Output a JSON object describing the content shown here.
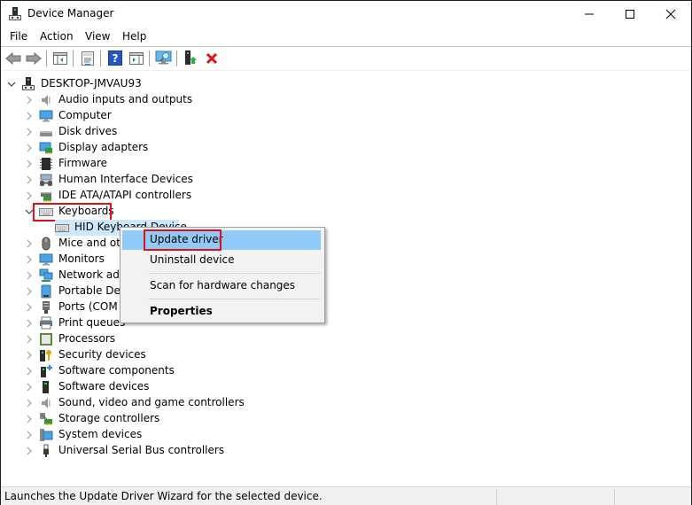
{
  "window": {
    "title": "Device Manager",
    "controls": {
      "minimize": "minimize",
      "maximize": "maximize",
      "close": "close"
    }
  },
  "menu": [
    "File",
    "Action",
    "View",
    "Help"
  ],
  "toolbar": {
    "buttons": [
      {
        "icon": "back-arrow-icon"
      },
      {
        "icon": "forward-arrow-icon"
      },
      {
        "icon": "show-hide-console-tree-icon"
      },
      {
        "icon": "properties-sheet-icon"
      },
      {
        "icon": "help-icon"
      },
      {
        "icon": "show-action-pane-icon"
      },
      {
        "icon": "scan-hardware-icon"
      },
      {
        "icon": "update-driver-icon"
      },
      {
        "icon": "uninstall-red-x-icon"
      }
    ]
  },
  "tree": {
    "root": "DESKTOP-JMVAU93",
    "categories": [
      {
        "label": "Audio inputs and outputs",
        "icon": "speaker-icon"
      },
      {
        "label": "Computer",
        "icon": "monitor-icon"
      },
      {
        "label": "Disk drives",
        "icon": "disk-drive-icon"
      },
      {
        "label": "Display adapters",
        "icon": "display-adapter-icon"
      },
      {
        "label": "Firmware",
        "icon": "chip-icon"
      },
      {
        "label": "Human Interface Devices",
        "icon": "hid-icon"
      },
      {
        "label": "IDE ATA/ATAPI controllers",
        "icon": "ide-controller-icon"
      },
      {
        "label": "Keyboards",
        "icon": "keyboard-icon",
        "expanded": true,
        "children": [
          "HID Keyboard Device"
        ]
      },
      {
        "label": "Mice and other pointing devices",
        "icon": "mouse-icon"
      },
      {
        "label": "Monitors",
        "icon": "monitor-icon"
      },
      {
        "label": "Network adapters",
        "icon": "network-icon"
      },
      {
        "label": "Portable Devices",
        "icon": "portable-device-icon"
      },
      {
        "label": "Ports (COM & LPT)",
        "icon": "port-icon"
      },
      {
        "label": "Print queues",
        "icon": "printer-icon"
      },
      {
        "label": "Processors",
        "icon": "processor-icon"
      },
      {
        "label": "Security devices",
        "icon": "security-key-icon"
      },
      {
        "label": "Software components",
        "icon": "software-component-icon"
      },
      {
        "label": "Software devices",
        "icon": "software-device-icon"
      },
      {
        "label": "Sound, video and game controllers",
        "icon": "speaker-icon"
      },
      {
        "label": "Storage controllers",
        "icon": "storage-controller-icon"
      },
      {
        "label": "System devices",
        "icon": "system-devices-icon"
      },
      {
        "label": "Universal Serial Bus controllers",
        "icon": "usb-icon"
      }
    ]
  },
  "context_menu": {
    "items": [
      {
        "label": "Update driver",
        "highlighted": true
      },
      {
        "label": "Uninstall device"
      },
      {
        "label": "Scan for hardware changes"
      },
      {
        "label": "Properties",
        "bold": true
      }
    ]
  },
  "status": {
    "text": "Launches the Update Driver Wizard for the selected device."
  },
  "colors": {
    "highlight_box": "#e0101a",
    "selection": "#cce8ff",
    "menu_hover": "#91c9f7"
  }
}
